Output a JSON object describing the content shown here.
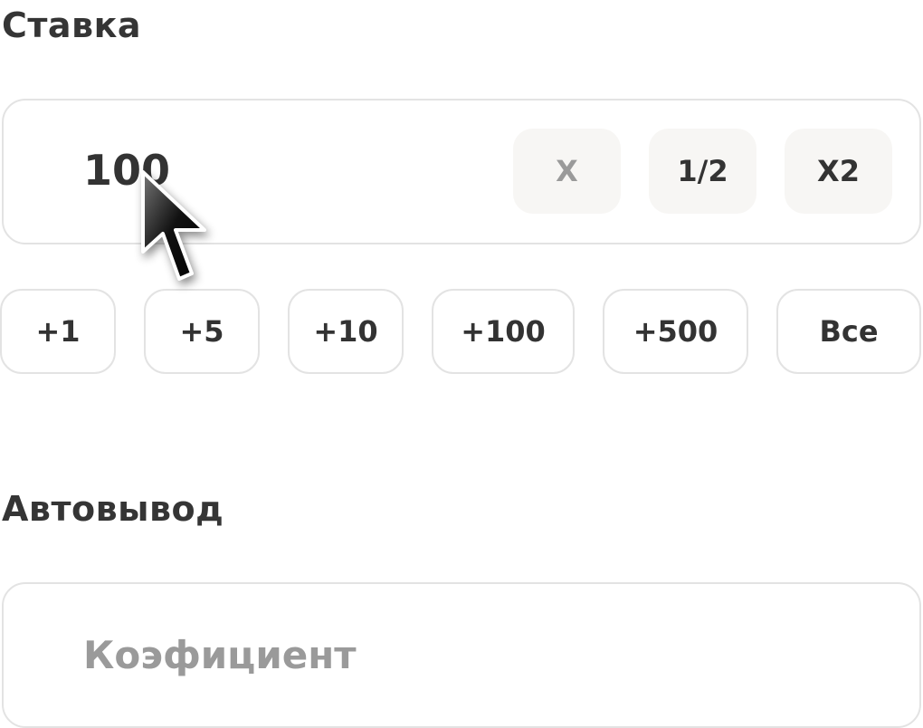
{
  "stake": {
    "label": "Ставка",
    "value": "100",
    "buttons": {
      "clear": "X",
      "half": "1/2",
      "double": "X2"
    },
    "increments": [
      "+1",
      "+5",
      "+10",
      "+100",
      "+500",
      "Все"
    ]
  },
  "autocashout": {
    "label": "Автовывод",
    "placeholder": "Коэфициент"
  }
}
